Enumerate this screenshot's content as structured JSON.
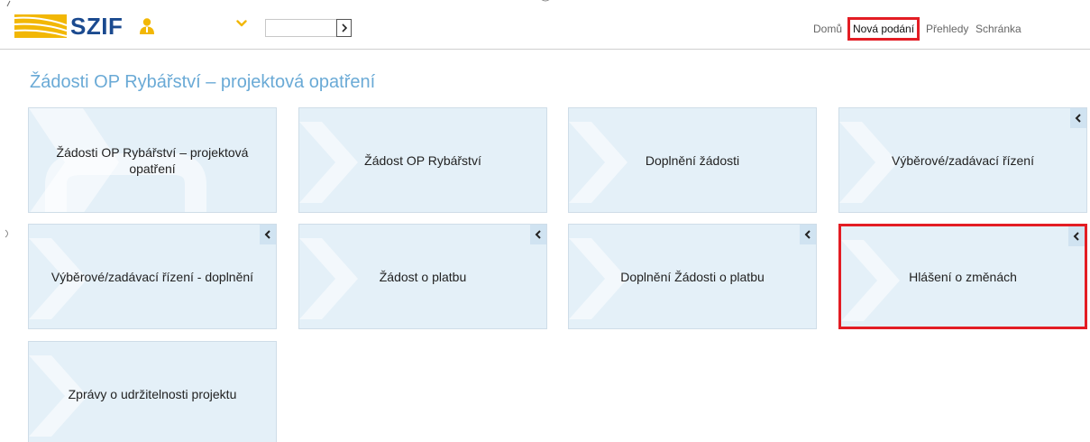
{
  "header": {
    "logo_text": "SZIF",
    "search_input_value": "",
    "nav": {
      "home": "Domů",
      "new_submissions": "Nová podání",
      "overviews": "Přehledy",
      "inbox": "Schránka"
    }
  },
  "colors": {
    "brand_blue": "#1b4a8f",
    "brand_yellow": "#f2b705",
    "title_blue": "#6aaad6",
    "tile_background": "#e4f0f8",
    "highlight_red": "#e31d24"
  },
  "main": {
    "title": "Žádosti OP Rybářství – projektová opatření",
    "tiles": [
      {
        "label": "Žádosti OP Rybářství – projektová opatření",
        "icon": "arrow-watermark-icon"
      },
      {
        "label": "Žádost OP Rybářství",
        "icon": "arrow-watermark-icon"
      },
      {
        "label": "Doplnění žádosti",
        "icon": "arrow-watermark-icon"
      },
      {
        "label": "Výběrové/zadávací řízení",
        "icon": "collapse-left-icon"
      },
      {
        "label": "Výběrové/zadávací řízení - doplnění",
        "icon": "collapse-left-icon"
      },
      {
        "label": "Žádost o platbu",
        "icon": "collapse-left-icon"
      },
      {
        "label": "Doplnění Žádosti o platbu",
        "icon": "collapse-left-icon"
      },
      {
        "label": "Hlášení o změnách",
        "icon": "collapse-left-icon"
      },
      {
        "label": "Zprávy o udržitelnosti projektu",
        "icon": "arrow-watermark-icon"
      }
    ]
  }
}
